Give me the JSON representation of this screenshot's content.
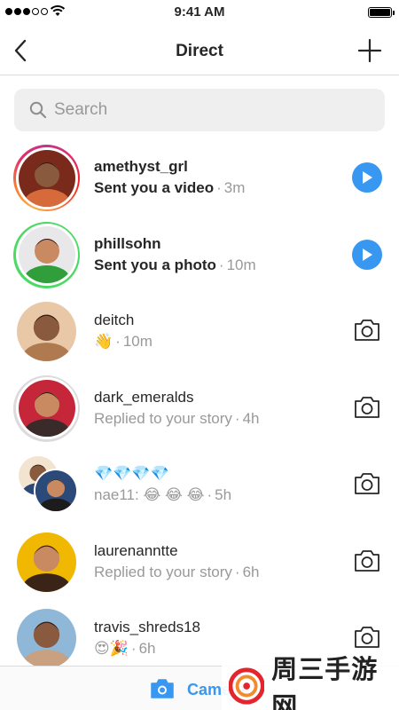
{
  "status_bar": {
    "time": "9:41 AM",
    "signal_bars": 3,
    "signal_total": 5
  },
  "header": {
    "title": "Direct"
  },
  "search": {
    "placeholder": "Search"
  },
  "threads": [
    {
      "username": "amethyst_grl",
      "message": "Sent you a video",
      "time": "3m",
      "bold": true,
      "ring": "story",
      "action": "play",
      "avatar_colors": [
        "#7a2a1a",
        "#d76a3a"
      ]
    },
    {
      "username": "phillsohn",
      "message": "Sent you a photo",
      "time": "10m",
      "bold": true,
      "ring": "green",
      "action": "play",
      "avatar_colors": [
        "#e8e8ea",
        "#2f9e3b"
      ]
    },
    {
      "username": "deitch",
      "message": "👋",
      "time": "10m",
      "bold": false,
      "ring": "none",
      "action": "camera",
      "avatar_colors": [
        "#e9c8a8",
        "#b07a50"
      ]
    },
    {
      "username": "dark_emeralds",
      "message": "Replied to your story",
      "time": "4h",
      "bold": false,
      "ring": "grey",
      "action": "camera",
      "avatar_colors": [
        "#c5263a",
        "#3a2a2a"
      ]
    },
    {
      "username": "💎💎💎💎",
      "message": "nae11: 😂 😂 😂",
      "time": "5h",
      "bold": false,
      "ring": "none",
      "action": "camera",
      "group": true,
      "avatar_colors": [
        "#f2e4d0",
        "#2b4a7a"
      ]
    },
    {
      "username": "laurenanntte",
      "message": "Replied to your story",
      "time": "6h",
      "bold": false,
      "ring": "none",
      "action": "camera",
      "avatar_colors": [
        "#f0b800",
        "#3a2418"
      ]
    },
    {
      "username": "travis_shreds18",
      "message": "😍🎉",
      "time": "6h",
      "bold": false,
      "ring": "none",
      "action": "camera",
      "avatar_colors": [
        "#8fb8d8",
        "#c9a080"
      ]
    }
  ],
  "bottom_bar": {
    "camera_label": "Camera"
  },
  "watermark": {
    "text": "周三手游网"
  },
  "colors": {
    "accent": "#3897f0",
    "secondary_text": "#999999",
    "online_ring": "#4cd964"
  }
}
